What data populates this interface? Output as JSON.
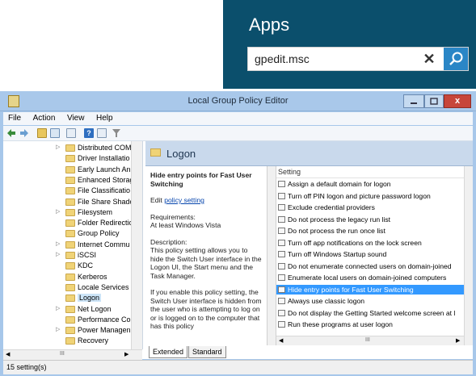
{
  "apps": {
    "title": "Apps",
    "search_value": "gpedit.msc",
    "clear_glyph": "✕",
    "go_icon": "search-icon"
  },
  "window": {
    "title": "Local Group Policy Editor",
    "close_glyph": "x"
  },
  "menu": [
    "File",
    "Action",
    "View",
    "Help"
  ],
  "tree": {
    "items": [
      {
        "label": "Distributed COM",
        "expandable": true
      },
      {
        "label": "Driver Installatio",
        "expandable": false
      },
      {
        "label": "Early Launch An",
        "expandable": false
      },
      {
        "label": "Enhanced Storag",
        "expandable": false
      },
      {
        "label": "File Classificatio",
        "expandable": false
      },
      {
        "label": "File Share Shado",
        "expandable": false
      },
      {
        "label": "Filesystem",
        "expandable": true
      },
      {
        "label": "Folder Redirectic",
        "expandable": false
      },
      {
        "label": "Group Policy",
        "expandable": false
      },
      {
        "label": "Internet Commu",
        "expandable": true
      },
      {
        "label": "iSCSI",
        "expandable": true
      },
      {
        "label": "KDC",
        "expandable": false
      },
      {
        "label": "Kerberos",
        "expandable": false
      },
      {
        "label": "Locale Services",
        "expandable": false
      },
      {
        "label": "Logon",
        "expandable": false,
        "selected": true
      },
      {
        "label": "Net Logon",
        "expandable": true
      },
      {
        "label": "Performance Co",
        "expandable": false
      },
      {
        "label": "Power Managen",
        "expandable": true
      },
      {
        "label": "Recovery",
        "expandable": false
      }
    ],
    "hscroll_glyph": "III"
  },
  "pane": {
    "header": "Logon",
    "desc_title": "Hide entry points for Fast User Switching",
    "edit_prefix": "Edit",
    "edit_link": "policy setting",
    "requirements_label": "Requirements:",
    "requirements_value": "At least Windows Vista",
    "description_label": "Description:",
    "description_1": "This policy setting allows you to hide the Switch User interface in the Logon UI, the Start menu and the Task Manager.",
    "description_2": "If you enable this policy setting, the Switch User interface is hidden from the user who is attempting to log on or is logged on to the computer that has this policy"
  },
  "settings": {
    "column_header": "Setting",
    "items": [
      "Assign a default domain for logon",
      "Turn off PIN logon and picture password logon",
      "Exclude credential providers",
      "Do not process the legacy run list",
      "Do not process the run once list",
      "Turn off app notifications on the lock screen",
      "Turn off Windows Startup sound",
      "Do not enumerate connected users on domain-joined",
      "Enumerate local users on domain-joined computers",
      "Hide entry points for Fast User Switching",
      "Always use classic logon",
      "Do not display the Getting Started welcome screen at l",
      "Run these programs at user logon"
    ],
    "selected_index": 9,
    "hscroll_glyph": "III"
  },
  "tabs": [
    "Extended",
    "Standard"
  ],
  "status": "15 setting(s)"
}
